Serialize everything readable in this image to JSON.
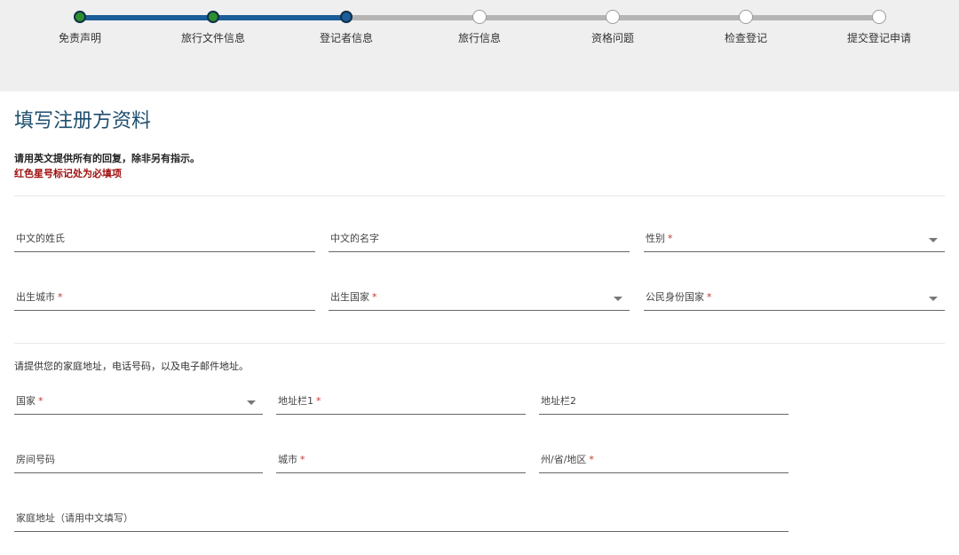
{
  "stepper": {
    "steps": [
      {
        "label": "免责声明",
        "state": "done"
      },
      {
        "label": "旅行文件信息",
        "state": "done"
      },
      {
        "label": "登记者信息",
        "state": "current"
      },
      {
        "label": "旅行信息",
        "state": "todo"
      },
      {
        "label": "资格问题",
        "state": "todo"
      },
      {
        "label": "检查登记",
        "state": "todo"
      },
      {
        "label": "提交登记申请",
        "state": "todo"
      }
    ]
  },
  "header": {
    "title": "填写注册方资料",
    "instruction": "请用英文提供所有的回复，除非另有指示。",
    "required_note": "红色星号标记处为必填项"
  },
  "personal": {
    "surname_cn": "中文的姓氏",
    "given_name_cn": "中文的名字",
    "gender": "性别",
    "birth_city": "出生城市",
    "birth_country": "出生国家",
    "citizenship_country": "公民身份国家"
  },
  "address": {
    "note": "请提供您的家庭地址，电话号码，以及电子邮件地址。",
    "country": "国家",
    "line1": "地址栏1",
    "line2": "地址栏2",
    "apartment": "房间号码",
    "city": "城市",
    "state": "州/省/地区",
    "home_address_cn": "家庭地址（请用中文填写）"
  },
  "required_marker": "*",
  "colors": {
    "accent": "#1c5d99",
    "done": "#2f8f2f",
    "required": "#a01010"
  }
}
